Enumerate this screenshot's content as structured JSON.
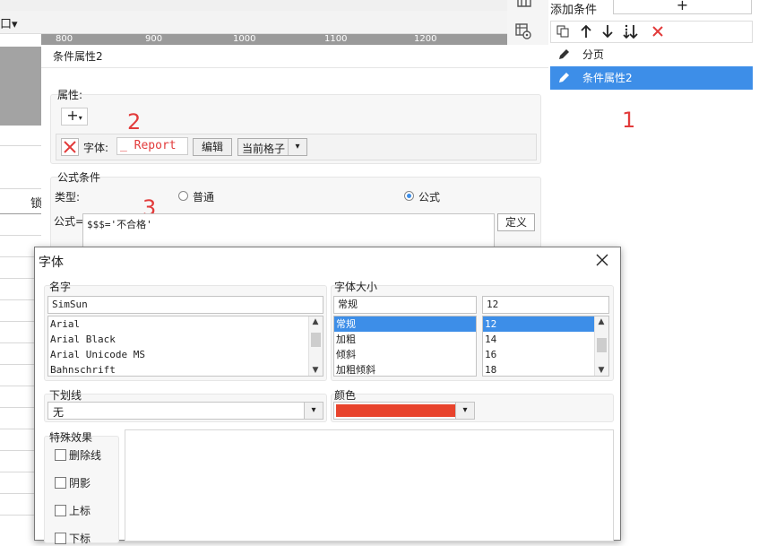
{
  "ruler": {
    "ticks": [
      "800",
      "900",
      "1000",
      "1100",
      "1200"
    ]
  },
  "toolbar": {
    "frame_glyph": "口▾"
  },
  "sheet": {
    "cut_header": "锁"
  },
  "condition_panel": {
    "add_label": "添加条件",
    "add_glyph": "+",
    "items": [
      {
        "label": "分页",
        "selected": false
      },
      {
        "label": "条件属性2",
        "selected": true
      }
    ]
  },
  "annotations": {
    "one": "1",
    "two": "2",
    "three": "3"
  },
  "prop_dialog": {
    "title": "条件属性2",
    "attr_group_label": "属性:",
    "add_glyph": "+",
    "font_label": "字体:",
    "font_preview": "_ Report",
    "edit_label": "编辑",
    "scope_value": "当前格子",
    "formula_group_label": "公式条件",
    "type_label": "类型:",
    "radio_normal": "普通",
    "radio_formula": "公式",
    "formula_label": "公式=",
    "formula_value": "$$$='不合格'",
    "define_label": "定义"
  },
  "font_dialog": {
    "title": "字体",
    "name_label": "名字",
    "name_value": "SimSun",
    "name_options": [
      "Arial",
      "Arial Black",
      "Arial Unicode MS",
      "Bahnschrift"
    ],
    "size_group_label": "字体大小",
    "style_value": "常规",
    "style_options": [
      "常规",
      "加粗",
      "倾斜",
      "加粗倾斜"
    ],
    "size_value": "12",
    "size_options": [
      "12",
      "14",
      "16",
      "18"
    ],
    "underline_label": "下划线",
    "underline_value": "无",
    "color_label": "颜色",
    "color_value": "#e8432c",
    "effects_label": "特殊效果",
    "effects": [
      "删除线",
      "阴影",
      "上标",
      "下标"
    ]
  }
}
